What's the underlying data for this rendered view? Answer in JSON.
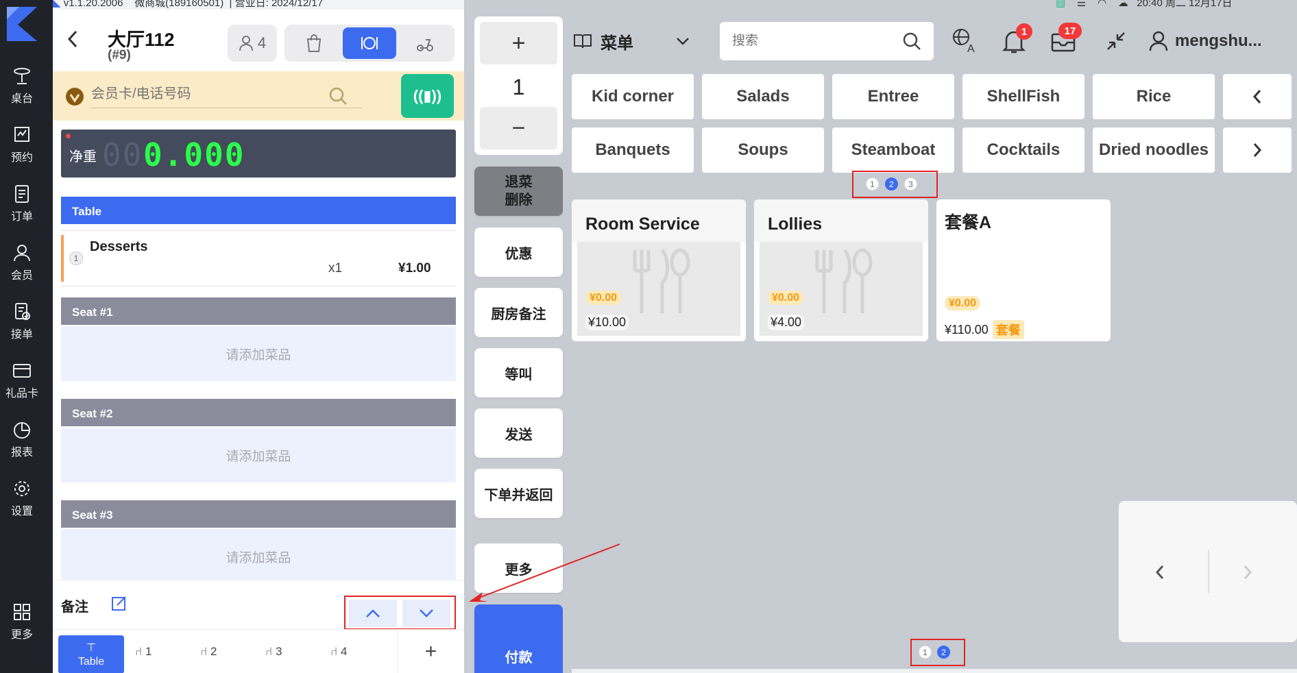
{
  "app": {
    "version": "v1.1.20.2006",
    "shop": "微商城(189160501)",
    "business_date": "营业日: 2024/12/17",
    "clock": "20:40 周二 12月17日"
  },
  "nav": {
    "items": [
      {
        "label": "桌台",
        "icon": "table-icon"
      },
      {
        "label": "预约",
        "icon": "reservation-icon"
      },
      {
        "label": "订单",
        "icon": "order-icon"
      },
      {
        "label": "会员",
        "icon": "member-icon"
      },
      {
        "label": "接单",
        "icon": "accept-order-icon"
      },
      {
        "label": "礼品卡",
        "icon": "gift-card-icon"
      },
      {
        "label": "报表",
        "icon": "report-icon"
      },
      {
        "label": "设置",
        "icon": "settings-icon"
      },
      {
        "label": "更多",
        "icon": "more-grid-icon"
      }
    ]
  },
  "order": {
    "table_name": "大厅112",
    "order_no": "(#9)",
    "guests": "4",
    "member_placeholder": "会员卡/电话号码",
    "scale_label": "净重",
    "scale_value": "0.000",
    "scale_leading": "00",
    "table_section": "Table",
    "items": [
      {
        "index": "1",
        "name": "Desserts",
        "qty": "x1",
        "price": "¥1.00"
      }
    ],
    "seats": [
      {
        "label": "Seat #1",
        "placeholder": "请添加菜品"
      },
      {
        "label": "Seat #2",
        "placeholder": "请添加菜品"
      },
      {
        "label": "Seat #3",
        "placeholder": "请添加菜品"
      }
    ],
    "remark_label": "备注",
    "seat_tabs": [
      {
        "label": "Table",
        "active": true
      },
      {
        "label": "1"
      },
      {
        "label": "2"
      },
      {
        "label": "3"
      },
      {
        "label": "4"
      }
    ],
    "add_seat": "+"
  },
  "actions": {
    "qty_plus": "+",
    "qty_value": "1",
    "qty_minus": "−",
    "void_delete_1": "退菜",
    "void_delete_2": "删除",
    "discount": "优惠",
    "kitchen_note": "厨房备注",
    "hold": "等叫",
    "send": "发送",
    "place_and_return": "下单并返回",
    "more": "更多",
    "pay": "付款"
  },
  "menu": {
    "title": "菜单",
    "search_placeholder": "搜索",
    "notif_count": "1",
    "orders_count": "17",
    "user": "mengshu...",
    "categories_row1": [
      "Kid corner",
      "Salads",
      "Entree",
      "ShellFish",
      "Rice"
    ],
    "categories_row2": [
      "Banquets",
      "Soups",
      "Steamboat",
      "Cocktails",
      "Dried noodles"
    ],
    "cat_pages": [
      "1",
      "2",
      "3"
    ],
    "cat_page_active": "2",
    "dishes": [
      {
        "name": "Room Service",
        "member_price": "¥0.00",
        "price": "¥10.00",
        "tag": ""
      },
      {
        "name": "Lollies",
        "member_price": "¥0.00",
        "price": "¥4.00",
        "tag": ""
      },
      {
        "name": "套餐A",
        "member_price": "¥0.00",
        "price": "¥110.00",
        "tag": "套餐"
      }
    ],
    "dish_pages": [
      "1",
      "2"
    ],
    "dish_page_active": "2"
  },
  "colors": {
    "accent": "#3d6bf0",
    "nav_bg": "#1f2329",
    "annotation_red": "#e02424",
    "teal": "#1dbf8f"
  }
}
